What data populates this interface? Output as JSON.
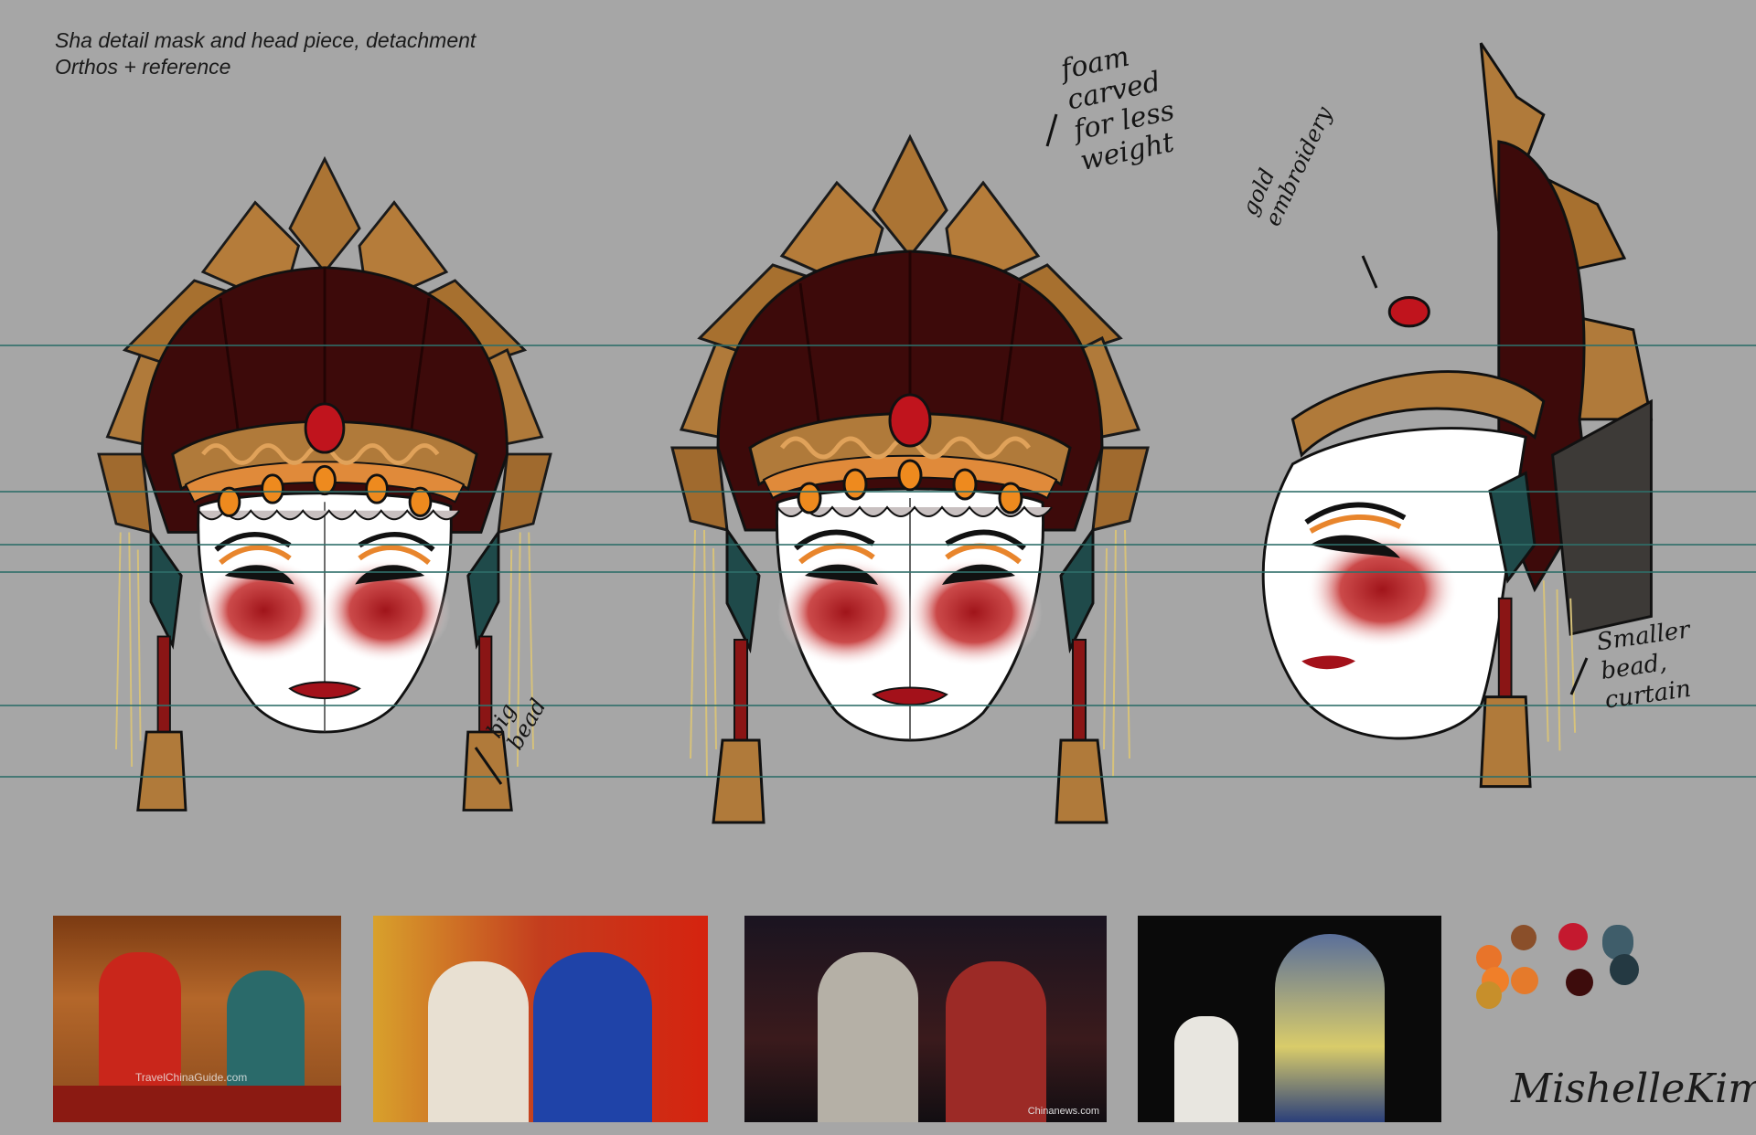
{
  "caption": {
    "line1": "Sha detail mask and head piece, detachment",
    "line2": "Orthos + reference"
  },
  "notes": {
    "foam": "foam\ncarved\nfor less\nweight",
    "gold": "gold\nembroidery",
    "big_bead": "big\nbead",
    "smaller_bead": "Smaller\nbead,\ncurtain"
  },
  "signature": "MishelleKim",
  "references": [
    {
      "watermark": "TravelChinaGuide.com"
    },
    {
      "watermark": ""
    },
    {
      "watermark": "Chinanews.com"
    },
    {
      "watermark": ""
    }
  ],
  "palette": [
    "#e8742a",
    "#8a4f2a",
    "#c4192f",
    "#3f5d6a",
    "#f07f29",
    "#e57a2b",
    "#3d0c0c",
    "#243942",
    "#c78f2b"
  ],
  "colors": {
    "background": "#a6a6a6",
    "guide_line": "#2f6f6a",
    "gold": "#b07a3a",
    "maroon": "#3d0a0a",
    "face": "#ffffff",
    "red": "#b81d22"
  }
}
